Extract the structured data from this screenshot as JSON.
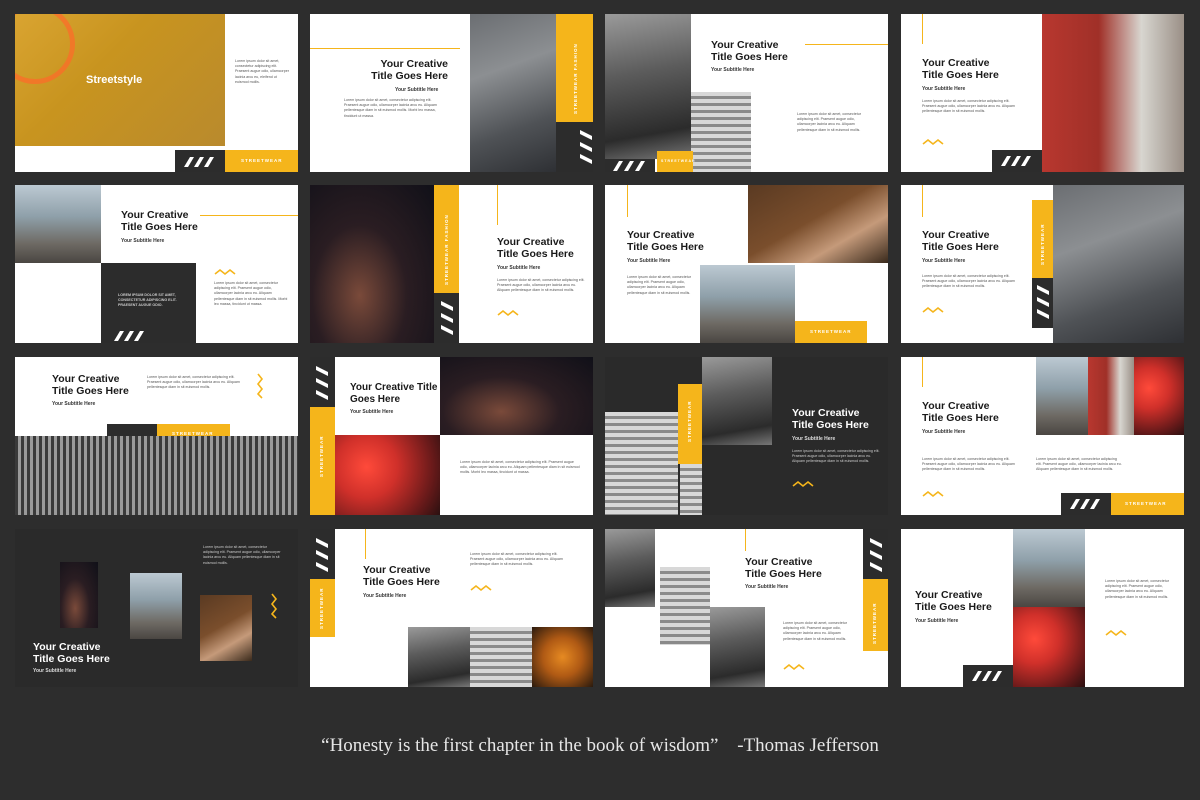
{
  "slides": {
    "s1": {
      "title": "Streetstyle",
      "label": "STREETWEAR",
      "body": "Lorem ipsum dolor sit amet, consectetur adipiscing elit. Praesent augue odio, ullamcorper lacinia arcu eu, eleifend ut euismod mollis."
    },
    "s2": {
      "title": "Your Creative Title Goes Here",
      "subtitle": "Your Subtitle Here",
      "label": "STREETWEAR FASHION",
      "body": "Lorem ipsum dolor sit amet, consectetur adipiscing elit. Praesent augue odio, ullamcorper lacinia arcu eu. Aliquam pellentesque diam in sit euismod mollis. Morbi leo massa, tincidunt ut massa."
    },
    "s3": {
      "title": "Your Creative Title Goes Here",
      "subtitle": "Your Subtitle Here",
      "label": "STREETWEAR",
      "body": "Lorem ipsum dolor sit amet, consectetur adipiscing elit. Praesent augue odio, ullamcorper lacinia arcu eu. Aliquam pellentesque diam in sit euismod mollis."
    },
    "s4": {
      "title": "Your Creative Title Goes Here",
      "subtitle": "Your Subtitle Here",
      "body": "Lorem ipsum dolor sit amet, consectetur adipiscing elit. Praesent augue odio, ullamcorper lacinia arcu eu. Aliquam pellentesque diam in sit euismod mollis."
    },
    "s5": {
      "title": "Your Creative Title Goes Here",
      "subtitle": "Your Subtitle Here",
      "dark_text": "LOREM IPSUM DOLOR SIT AMET, CONSECTETUR ADIPISCING ELIT. PRAESENT AUGUE ODIO.",
      "body": "Lorem ipsum dolor sit amet, consectetur adipiscing elit. Praesent augue odio, ullamcorper lacinia arcu eu. Aliquam pellentesque diam in sit euismod mollis. Morbi leo massa, tincidunt ut massa."
    },
    "s6": {
      "title": "Your Creative Title Goes Here",
      "subtitle": "Your Subtitle Here",
      "label": "STREETWEAR FASHION",
      "body": "Lorem ipsum dolor sit amet, consectetur adipiscing elit. Praesent augue odio, ullamcorper lacinia arcu eu. Aliquam pellentesque diam in sit euismod mollis."
    },
    "s7": {
      "title": "Your Creative Title Goes Here",
      "subtitle": "Your Subtitle Here",
      "label": "STREETWEAR",
      "body": "Lorem ipsum dolor sit amet, consectetur adipiscing elit. Praesent augue odio, ullamcorper lacinia arcu eu. Aliquam pellentesque diam in sit euismod mollis."
    },
    "s8": {
      "title": "Your Creative Title Goes Here",
      "subtitle": "Your Subtitle Here",
      "label": "STREETWEAR",
      "body": "Lorem ipsum dolor sit amet, consectetur adipiscing elit. Praesent augue odio, ullamcorper lacinia arcu eu. Aliquam pellentesque diam in sit euismod mollis."
    },
    "s9": {
      "title": "Your Creative Title Goes Here",
      "subtitle": "Your Subtitle Here",
      "label": "STREETWEAR",
      "body": "Lorem ipsum dolor sit amet, consectetur adipiscing elit. Praesent augue odio, ullamcorper lacinia arcu eu. Aliquam pellentesque diam in sit euismod mollis."
    },
    "s10": {
      "title": "Your Creative Title Goes Here",
      "subtitle": "Your Subtitle Here",
      "label": "STREETWEAR",
      "body": "Lorem ipsum dolor sit amet, consectetur adipiscing elit. Praesent augue odio, ullamcorper lacinia arcu eu. Aliquam pellentesque diam in sit euismod mollis. Morbi leo massa, tincidunt ut massa."
    },
    "s11": {
      "title": "Your Creative Title Goes Here",
      "subtitle": "Your Subtitle Here",
      "label": "STREETWEAR",
      "body": "Lorem ipsum dolor sit amet, consectetur adipiscing elit. Praesent augue odio, ullamcorper lacinia arcu eu. Aliquam pellentesque diam in sit euismod mollis."
    },
    "s12": {
      "title": "Your Creative Title Goes Here",
      "subtitle": "Your Subtitle Here",
      "label": "STREETWEAR",
      "body": "Lorem ipsum dolor sit amet, consectetur adipiscing elit. Praesent augue odio, ullamcorper lacinia arcu eu. Aliquam pellentesque diam in sit euismod mollis."
    },
    "s13": {
      "title": "Your Creative Title Goes Here",
      "subtitle": "Your Subtitle Here",
      "body": "Lorem ipsum dolor sit amet, consectetur adipiscing elit. Praesent augue odio, ullamcorper lacinia arcu eu. Aliquam pellentesque diam in sit euismod mollis."
    },
    "s14": {
      "title": "Your Creative Title Goes Here",
      "subtitle": "Your Subtitle Here",
      "label": "STREETWEAR",
      "body": "Lorem ipsum dolor sit amet, consectetur adipiscing elit. Praesent augue odio, ullamcorper lacinia arcu eu. Aliquam pellentesque diam in sit euismod mollis."
    },
    "s15": {
      "title": "Your Creative Title Goes Here",
      "subtitle": "Your Subtitle Here",
      "label": "STREETWEAR",
      "body": "Lorem ipsum dolor sit amet, consectetur adipiscing elit. Praesent augue odio, ullamcorper lacinia arcu eu. Aliquam pellentesque diam in sit euismod mollis."
    },
    "s16": {
      "title": "Your Creative Title Goes Here",
      "subtitle": "Your Subtitle Here",
      "body": "Lorem ipsum dolor sit amet, consectetur adipiscing elit. Praesent augue odio, ullamcorper lacinia arcu eu. Aliquam pellentesque diam in sit euismod mollis."
    }
  },
  "quote": {
    "text": "“Honesty is the first chapter in the book of wisdom”",
    "author": "-Thomas Jefferson"
  },
  "colors": {
    "accent": "#f5b51b",
    "dark": "#2c2c2c",
    "background": "#2d2d2d"
  }
}
